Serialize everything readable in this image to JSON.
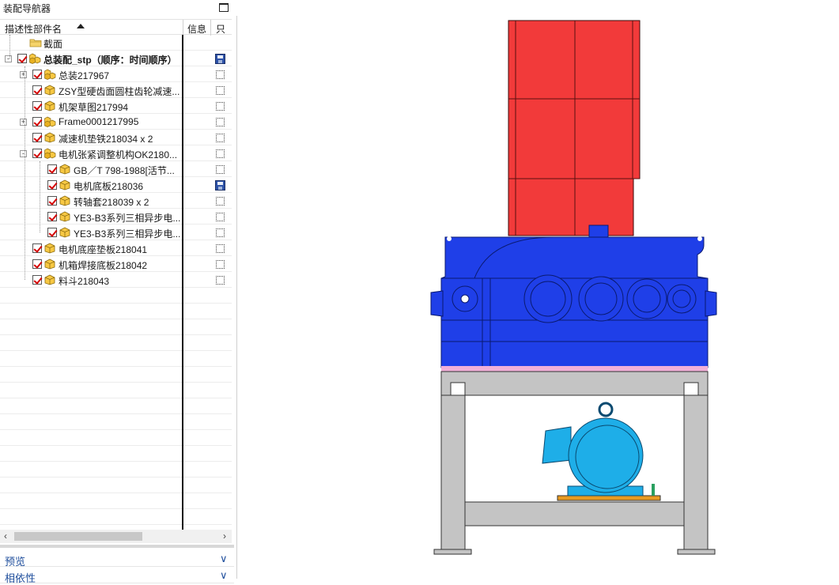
{
  "panel": {
    "title": "装配导航器",
    "columns": {
      "name": "描述性部件名",
      "info": "信息",
      "readonly": "只"
    }
  },
  "tree": {
    "rows": [
      {
        "label": "截面",
        "icon": "folder-icon",
        "indent": 1,
        "checkbox": false,
        "expander": "",
        "bold": false,
        "status": "none"
      },
      {
        "label": "总装配_stp（顺序：时间顺序）",
        "icon": "assembly-icon",
        "indent": 0,
        "checkbox": true,
        "expander": "-",
        "bold": true,
        "status": "save"
      },
      {
        "label": "总装217967",
        "icon": "assembly-icon",
        "indent": 1,
        "checkbox": true,
        "expander": "+",
        "bold": false,
        "status": "box"
      },
      {
        "label": "ZSY型硬齿面圆柱齿轮减速...",
        "icon": "part-icon",
        "indent": 1,
        "checkbox": true,
        "expander": "",
        "bold": false,
        "status": "box"
      },
      {
        "label": "机架草图217994",
        "icon": "part-icon",
        "indent": 1,
        "checkbox": true,
        "expander": "",
        "bold": false,
        "status": "box"
      },
      {
        "label": "Frame0001217995",
        "icon": "assembly-icon",
        "indent": 1,
        "checkbox": true,
        "expander": "+",
        "bold": false,
        "status": "box"
      },
      {
        "label": "减速机垫铁218034 x 2",
        "icon": "part-icon",
        "indent": 1,
        "checkbox": true,
        "expander": "",
        "bold": false,
        "status": "box"
      },
      {
        "label": "电机张紧调整机构OK2180...",
        "icon": "assembly-icon",
        "indent": 1,
        "checkbox": true,
        "expander": "-",
        "bold": false,
        "status": "box"
      },
      {
        "label": "GB／T 798-1988[活节...",
        "icon": "part-icon",
        "indent": 2,
        "checkbox": true,
        "expander": "",
        "bold": false,
        "status": "box"
      },
      {
        "label": "电机底板218036",
        "icon": "part-icon",
        "indent": 2,
        "checkbox": true,
        "expander": "",
        "bold": false,
        "status": "save"
      },
      {
        "label": "转轴套218039 x 2",
        "icon": "part-icon",
        "indent": 2,
        "checkbox": true,
        "expander": "",
        "bold": false,
        "status": "box"
      },
      {
        "label": "YE3-B3系列三相异步电...",
        "icon": "part-icon",
        "indent": 2,
        "checkbox": true,
        "expander": "",
        "bold": false,
        "status": "box"
      },
      {
        "label": "YE3-B3系列三相异步电...",
        "icon": "part-icon",
        "indent": 2,
        "checkbox": true,
        "expander": "",
        "bold": false,
        "status": "box"
      },
      {
        "label": "电机底座垫板218041",
        "icon": "part-icon",
        "indent": 1,
        "checkbox": true,
        "expander": "",
        "bold": false,
        "status": "box"
      },
      {
        "label": "机箱焊接底板218042",
        "icon": "part-icon",
        "indent": 1,
        "checkbox": true,
        "expander": "",
        "bold": false,
        "status": "box"
      },
      {
        "label": "料斗218043",
        "icon": "part-icon",
        "indent": 1,
        "checkbox": true,
        "expander": "",
        "bold": false,
        "status": "box"
      }
    ]
  },
  "sections": {
    "preview": "预览",
    "dependencies": "相依性"
  },
  "colors": {
    "hopper": "#f23a3a",
    "gearbox": "#1f3fe8",
    "frame": "#c4c4c4",
    "motor": "#1eaee8",
    "pad": "#f2b0d8",
    "accent": "#1f4e9c"
  },
  "viewport": {
    "model": "hopper-gearbox-frame-motor-assembly"
  }
}
